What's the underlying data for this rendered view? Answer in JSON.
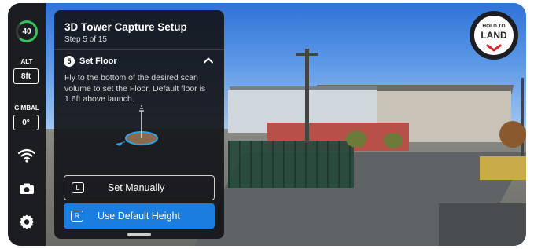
{
  "status": {
    "battery_level": "40"
  },
  "sidebar": {
    "alt_label": "ALT",
    "alt_value": "8ft",
    "gimbal_label": "GIMBAL",
    "gimbal_value": "0°",
    "icons": [
      "wifi-signal-icon",
      "camera-icon",
      "settings-gear-icon"
    ]
  },
  "panel": {
    "title": "3D Tower Capture Setup",
    "step": "Step 5 of 15",
    "section_number": "5",
    "section_title": "Set Floor",
    "description": "Fly to the bottom of the desired scan volume to set the Floor. Default floor is 1.6ft above launch.",
    "buttons": {
      "manual": {
        "key": "L",
        "label": "Set Manually"
      },
      "default": {
        "key": "R",
        "label": "Use Default Height"
      }
    }
  },
  "land_button": {
    "small": "HOLD TO",
    "big": "LAND"
  },
  "colors": {
    "accent": "#1a7ee0",
    "battery_ok": "#31c55a",
    "land_red": "#d9242b"
  }
}
